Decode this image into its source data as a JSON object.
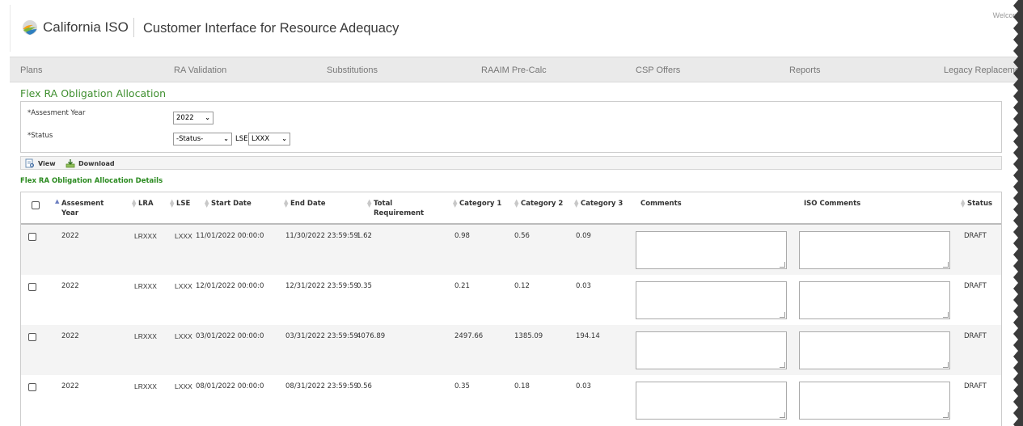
{
  "header": {
    "logo_text": "California ISO",
    "app_title": "Customer Interface for Resource Adequacy",
    "welcome": "Welcom"
  },
  "nav": {
    "items": [
      "Plans",
      "RA Validation",
      "Substitutions",
      "RAAIM Pre-Calc",
      "CSP Offers",
      "Reports",
      "Legacy Replacemen"
    ]
  },
  "page": {
    "title": "Flex RA Obligation Allocation"
  },
  "filters": {
    "year_label": "*Assesment Year",
    "year_value": "2022",
    "status_label": "*Status",
    "status_value": "-Status-",
    "lse_label": "LSE",
    "lse_value": "LXXX"
  },
  "toolbar": {
    "view_label": "View",
    "download_label": "Download"
  },
  "section": {
    "title": "Flex RA Obligation Allocation Details"
  },
  "table": {
    "headers": {
      "year_1": "Assesment",
      "year_2": "Year",
      "lra": "LRA",
      "lse": "LSE",
      "start": "Start Date",
      "end": "End Date",
      "total_1": "Total",
      "total_2": "Requirement",
      "cat1": "Category 1",
      "cat2": "Category 2",
      "cat3": "Category 3",
      "comments": "Comments",
      "iso_comments": "ISO Comments",
      "status": "Status"
    },
    "rows": [
      {
        "year": "2022",
        "lra": "LRXXX",
        "lse": "LXXX",
        "start": "11/01/2022 00:00:0",
        "end": "11/30/2022 23:59:59",
        "total": "1.62",
        "cat1": "0.98",
        "cat2": "0.56",
        "cat3": "0.09",
        "status": "DRAFT"
      },
      {
        "year": "2022",
        "lra": "LRXXX",
        "lse": "LXXX",
        "start": "12/01/2022 00:00:0",
        "end": "12/31/2022 23:59:59",
        "total": "0.35",
        "cat1": "0.21",
        "cat2": "0.12",
        "cat3": "0.03",
        "status": "DRAFT"
      },
      {
        "year": "2022",
        "lra": "LRXXX",
        "lse": "LXXX",
        "start": "03/01/2022 00:00:0",
        "end": "03/31/2022 23:59:59",
        "total": "4076.89",
        "cat1": "2497.66",
        "cat2": "1385.09",
        "cat3": "194.14",
        "status": "DRAFT"
      },
      {
        "year": "2022",
        "lra": "LRXXX",
        "lse": "LXXX",
        "start": "08/01/2022 00:00:0",
        "end": "08/31/2022 23:59:59",
        "total": "0.56",
        "cat1": "0.35",
        "cat2": "0.18",
        "cat3": "0.03",
        "status": "DRAFT"
      }
    ]
  },
  "icons": {
    "logo": "california-iso-logo",
    "view": "view-document-icon",
    "download": "download-icon",
    "sort": "sort-arrows-icon"
  },
  "colors": {
    "title_green": "#3f8f2f",
    "section_green": "#2a8a1f",
    "nav_bg": "#eaeaea",
    "row_alt": "#f4f4f4"
  }
}
